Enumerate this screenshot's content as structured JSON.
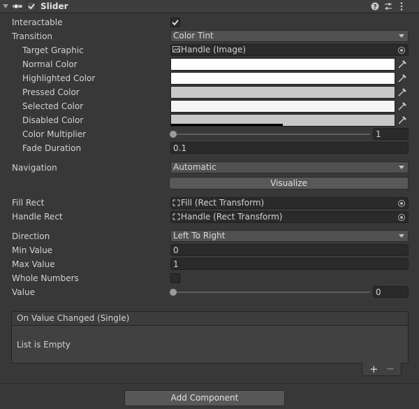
{
  "header": {
    "title": "Slider",
    "enabled": true
  },
  "properties": {
    "interactable": {
      "label": "Interactable",
      "checked": true
    },
    "transition": {
      "label": "Transition",
      "value": "Color Tint"
    },
    "target_graphic": {
      "label": "Target Graphic",
      "value": "Handle (Image)"
    },
    "normal_color": {
      "label": "Normal Color",
      "color": "#ffffff"
    },
    "highlighted_color": {
      "label": "Highlighted Color",
      "color": "#ffffff"
    },
    "pressed_color": {
      "label": "Pressed Color",
      "color": "#c8c8c8"
    },
    "selected_color": {
      "label": "Selected Color",
      "color": "#f5f5f5"
    },
    "disabled_color": {
      "label": "Disabled Color",
      "color": "#c8c8c8",
      "alpha": 0.5
    },
    "color_multiplier": {
      "label": "Color Multiplier",
      "value": "1",
      "fraction": 0
    },
    "fade_duration": {
      "label": "Fade Duration",
      "value": "0.1"
    },
    "navigation": {
      "label": "Navigation",
      "value": "Automatic",
      "visualize_label": "Visualize"
    },
    "fill_rect": {
      "label": "Fill Rect",
      "value": "Fill (Rect Transform)"
    },
    "handle_rect": {
      "label": "Handle Rect",
      "value": "Handle (Rect Transform)"
    },
    "direction": {
      "label": "Direction",
      "value": "Left To Right"
    },
    "min_value": {
      "label": "Min Value",
      "value": "0"
    },
    "max_value": {
      "label": "Max Value",
      "value": "1"
    },
    "whole_numbers": {
      "label": "Whole Numbers",
      "checked": false
    },
    "value": {
      "label": "Value",
      "value": "0",
      "fraction": 0
    }
  },
  "event": {
    "title": "On Value Changed (Single)",
    "empty_text": "List is Empty",
    "add_label": "+",
    "remove_label": "−"
  },
  "footer": {
    "add_component_label": "Add Component"
  },
  "icons": {
    "foldout": "chevron-down-icon",
    "script": "slider-script-icon",
    "help": "help-icon",
    "presets": "presets-icon",
    "menu": "kebab-menu-icon",
    "dropper": "eyedropper-icon",
    "picker": "object-picker-icon",
    "image": "image-icon",
    "rect_transform": "rect-transform-icon"
  }
}
